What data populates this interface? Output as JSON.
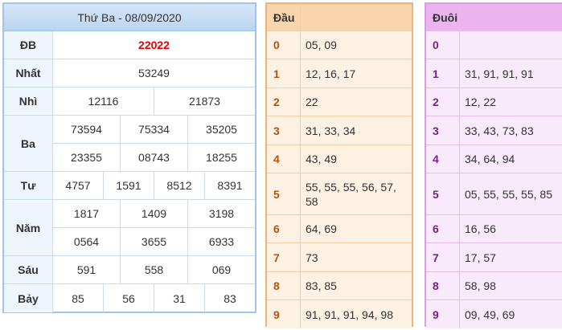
{
  "results": {
    "title": "Thứ Ba - 08/09/2020",
    "prizes": [
      {
        "label": "ĐB",
        "rows": [
          [
            "22022"
          ]
        ]
      },
      {
        "label": "Nhất",
        "rows": [
          [
            "53249"
          ]
        ]
      },
      {
        "label": "Nhì",
        "rows": [
          [
            "12116",
            "21873"
          ]
        ]
      },
      {
        "label": "Ba",
        "rows": [
          [
            "73594",
            "75334",
            "35205"
          ],
          [
            "23355",
            "08743",
            "18255"
          ]
        ]
      },
      {
        "label": "Tư",
        "rows": [
          [
            "4757",
            "1591",
            "8512",
            "8391"
          ]
        ]
      },
      {
        "label": "Năm",
        "rows": [
          [
            "1817",
            "1409",
            "3198"
          ],
          [
            "0564",
            "3655",
            "6933"
          ]
        ]
      },
      {
        "label": "Sáu",
        "rows": [
          [
            "591",
            "558",
            "069"
          ]
        ]
      },
      {
        "label": "Bảy",
        "rows": [
          [
            "85",
            "56",
            "31",
            "83"
          ]
        ]
      }
    ],
    "special_color": "#e00000"
  },
  "dau": {
    "header": "Đầu",
    "rows": [
      {
        "key": "0",
        "nums": "05, 09"
      },
      {
        "key": "1",
        "nums": "12, 16, 17"
      },
      {
        "key": "2",
        "nums": "22"
      },
      {
        "key": "3",
        "nums": "31, 33, 34"
      },
      {
        "key": "4",
        "nums": "43, 49"
      },
      {
        "key": "5",
        "nums": "55, 55, 55, 56, 57, 58"
      },
      {
        "key": "6",
        "nums": "64, 69"
      },
      {
        "key": "7",
        "nums": "73"
      },
      {
        "key": "8",
        "nums": "83, 85"
      },
      {
        "key": "9",
        "nums": "91, 91, 91, 94, 98"
      }
    ]
  },
  "duoi": {
    "header": "Đuôi",
    "rows": [
      {
        "key": "0",
        "nums": ""
      },
      {
        "key": "1",
        "nums": "31, 91, 91, 91"
      },
      {
        "key": "2",
        "nums": "12, 22"
      },
      {
        "key": "3",
        "nums": "33, 43, 73, 83"
      },
      {
        "key": "4",
        "nums": "34, 64, 94"
      },
      {
        "key": "5",
        "nums": "05, 55, 55, 55, 85"
      },
      {
        "key": "6",
        "nums": "16, 56"
      },
      {
        "key": "7",
        "nums": "17, 57"
      },
      {
        "key": "8",
        "nums": "58, 98"
      },
      {
        "key": "9",
        "nums": "09, 49, 69"
      }
    ]
  }
}
